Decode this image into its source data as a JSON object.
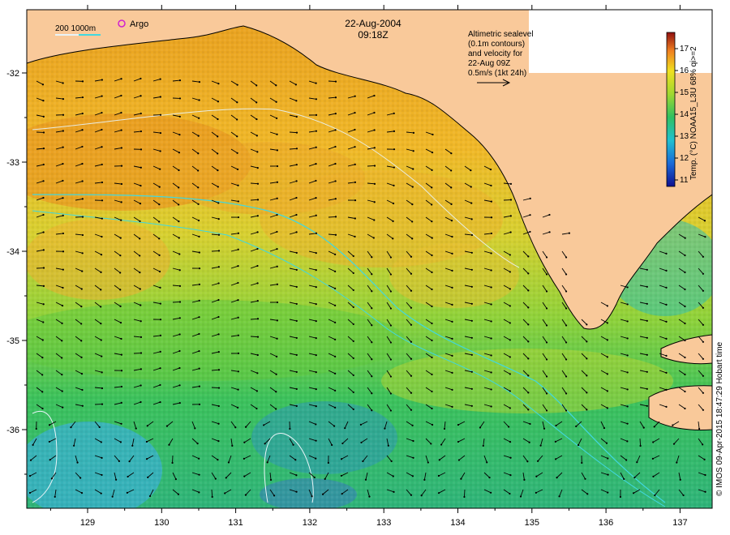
{
  "map": {
    "date": "22-Aug-2004",
    "time": "09:18Z",
    "contour_legend": "200  1000m",
    "argo_label": "Argo",
    "sealevel_note": [
      "Altimetric sealevel",
      "(0.1m contours)",
      "and velocity for",
      "22-Aug 09Z",
      "0.5m/s (1kt 24h)"
    ],
    "colorbar_label": "Temp. (°C) NOAA15_L3U 68% qi>=2",
    "colorbar_ticks": [
      "11",
      "12",
      "13",
      "14",
      "15",
      "16",
      "17"
    ],
    "credit": "© IMOS 09-Apr-2015 18:47:29 Hobart time",
    "x_ticks": [
      "129",
      "130",
      "131",
      "132",
      "133",
      "134",
      "135",
      "136",
      "137"
    ],
    "y_ticks": [
      "-32",
      "-33",
      "-34",
      "-35",
      "-36"
    ],
    "colors": {
      "land": "#f9c99a",
      "warm": "#e9a020",
      "mid": "#c6d62a",
      "cool": "#44c65a",
      "cold": "#1e9fd8"
    }
  }
}
